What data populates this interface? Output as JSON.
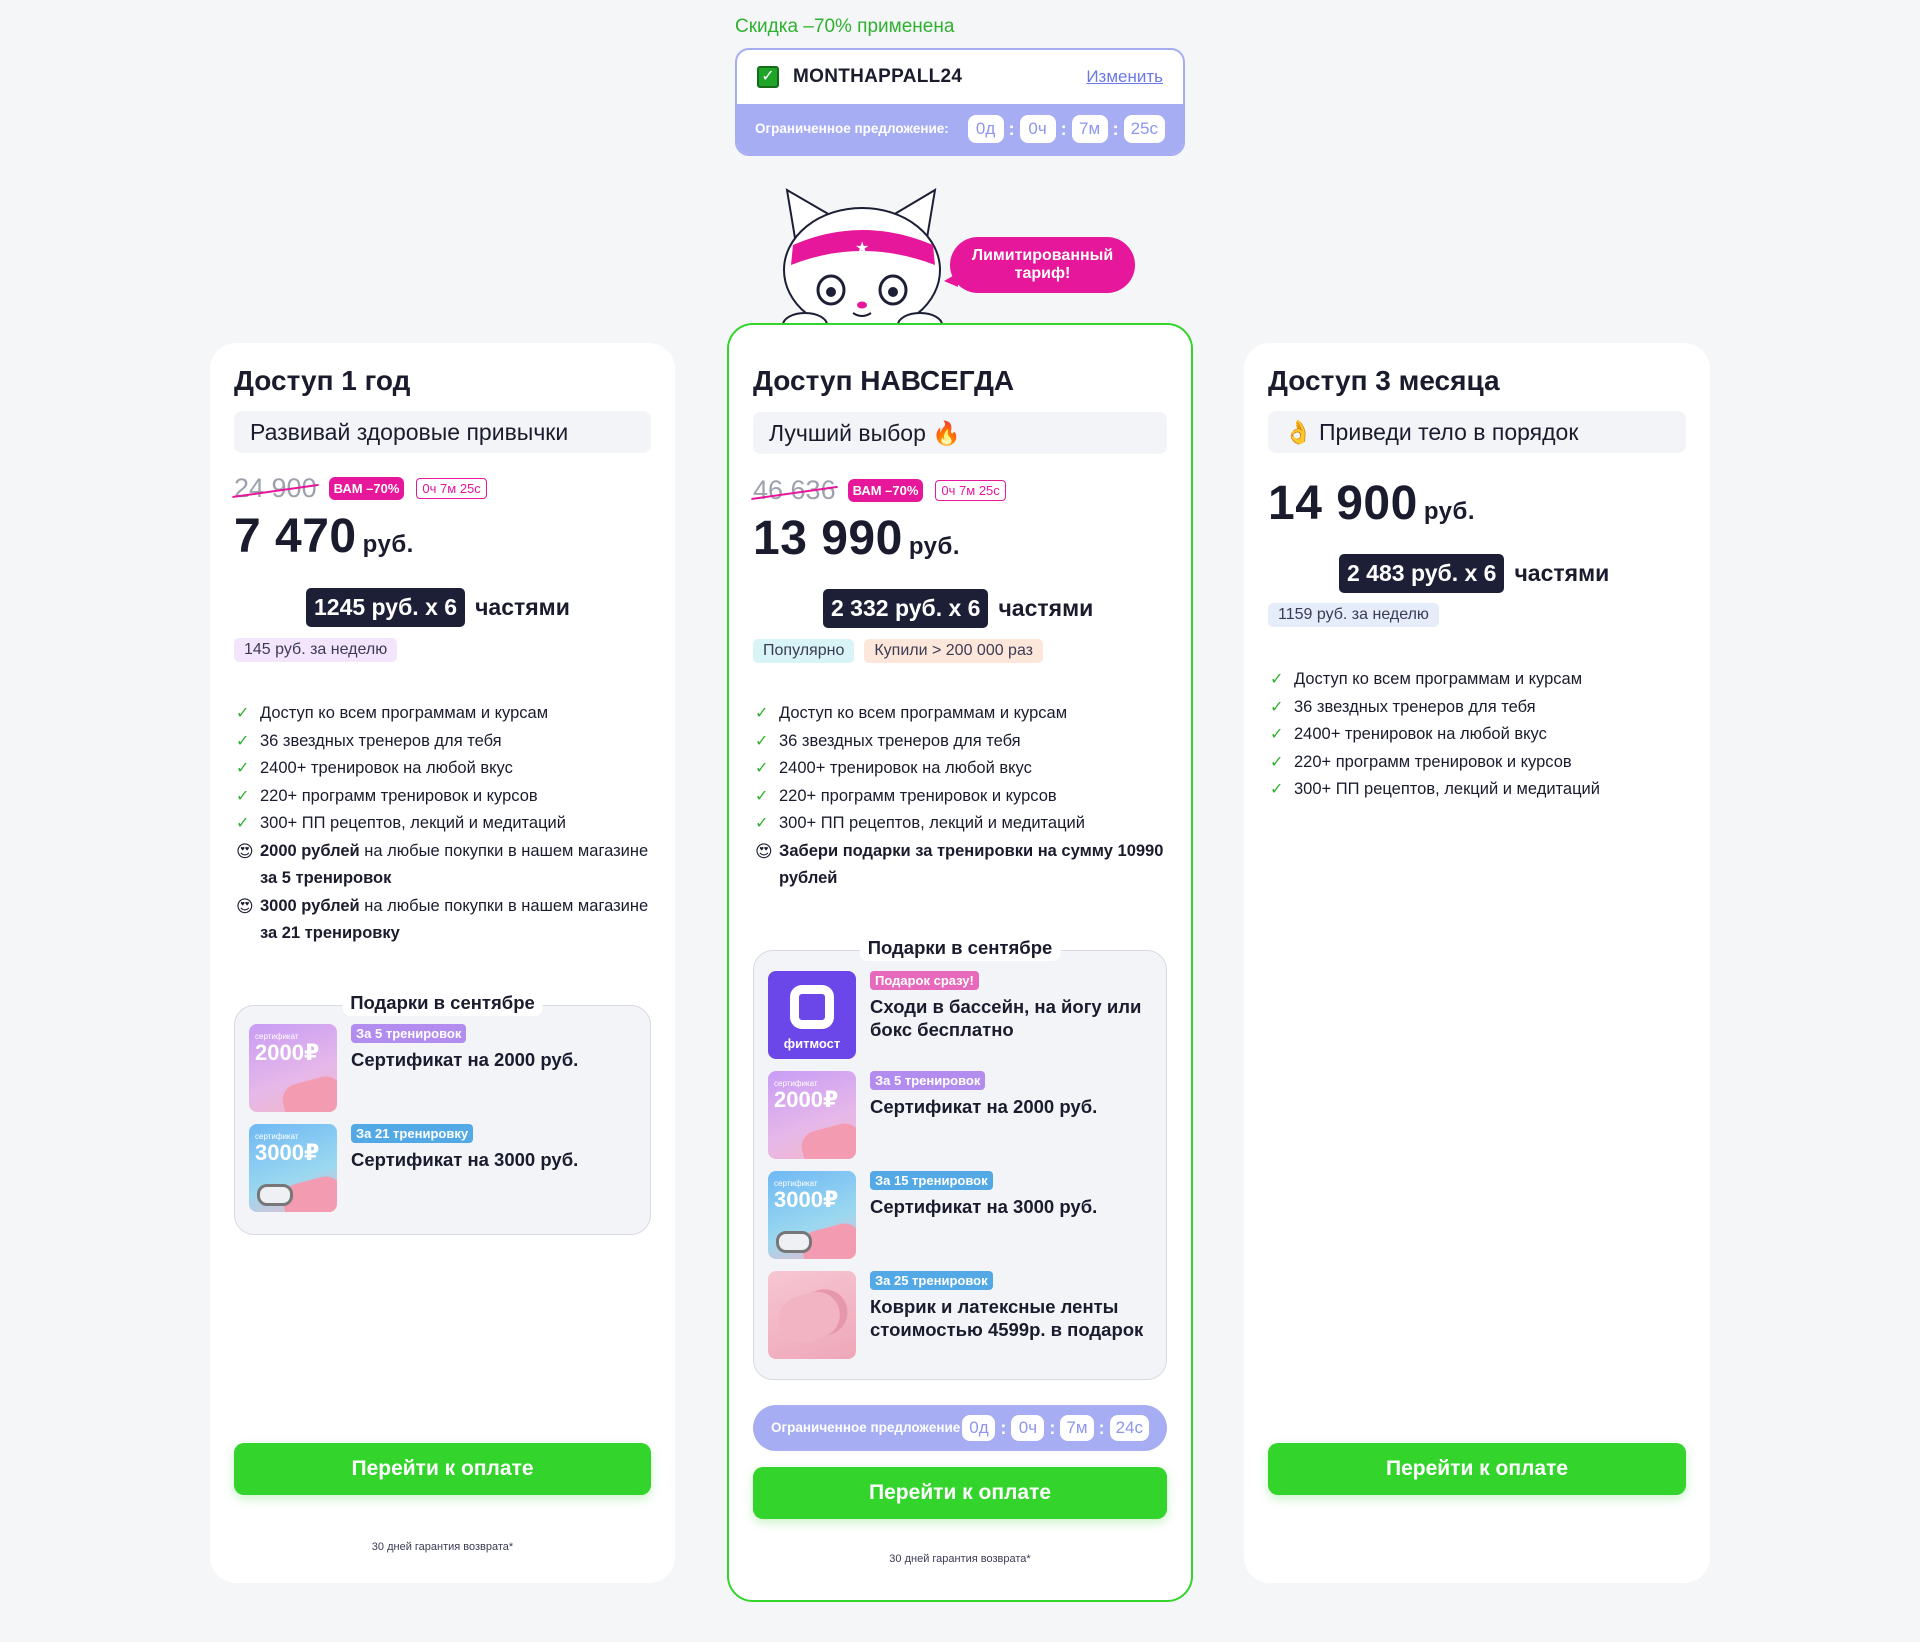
{
  "promo": {
    "applied": "Скидка –70% применена",
    "code": "MONTHAPPALL24",
    "change": "Изменить",
    "timer_label": "Ограниченное предложение:",
    "timer": [
      "0д",
      "0ч",
      "7м",
      "25с"
    ]
  },
  "bubble": "Лимитированный тариф!",
  "plans": [
    {
      "title": "Доступ 1 год",
      "subtitle": "Развивай здоровые привычки",
      "old_price": "24 900",
      "discount_badge": "ВАМ –70%",
      "countdown_badge": "0ч 7м 25с",
      "price": "7 470",
      "currency": "руб.",
      "installment": "1245 руб. x 6",
      "installment_suffix": "частями",
      "weekly": "145 руб. за неделю",
      "features": [
        "Доступ ко всем программам и курсам",
        "36 звездных тренеров для тебя",
        "2400+ тренировок на любой вкус",
        "220+ программ тренировок и курсов",
        "300+ ПП рецептов, лекций и медитаций"
      ],
      "bonus1": {
        "bold1": "2000 рублей",
        "text": " на любые покупки в нашем магазине ",
        "bold2": "за 5 тренировок"
      },
      "bonus2": {
        "bold1": "3000 рублей",
        "text": " на любые покупки в нашем магазине ",
        "bold2": "за 21 тренировку"
      },
      "gifts_title": "Подарки в сентябре",
      "gifts": [
        {
          "tag": "За 5 тренировок",
          "text": "Сертификат на 2000 руб.",
          "img_small": "сертификат",
          "img_amount": "2000₽"
        },
        {
          "tag": "За 21 тренировку",
          "text": "Сертификат на 3000 руб.",
          "img_small": "сертификат",
          "img_amount": "3000₽"
        }
      ],
      "pay": "Перейти к оплате",
      "guarantee": "30 дней гарантия возврата*"
    },
    {
      "title": "Доступ НАВСЕГДА",
      "subtitle": "Лучший выбор 🔥",
      "old_price": "46 636",
      "discount_badge": "ВАМ –70%",
      "countdown_badge": "0ч 7м 25с",
      "price": "13 990",
      "currency": "руб.",
      "installment": "2 332 руб. x 6",
      "installment_suffix": "частями",
      "chip_popular": "Популярно",
      "chip_bought": "Купили > 200 000 раз",
      "features": [
        "Доступ ко всем программам и курсам",
        "36 звездных тренеров для тебя",
        "2400+ тренировок на любой вкус",
        "220+ программ тренировок и курсов",
        "300+ ПП рецептов, лекций и медитаций"
      ],
      "bonus": "Забери подарки за тренировки на сумму 10990 рублей",
      "gifts_title": "Подарки в сентябре",
      "gifts": [
        {
          "tag": "Подарок сразу!",
          "text": "Сходи в бассейн, на йогу или бокс бесплатно",
          "img_label": "фитмост"
        },
        {
          "tag": "За 5 тренировок",
          "text": "Сертификат на 2000 руб.",
          "img_small": "сертификат",
          "img_amount": "2000₽"
        },
        {
          "tag": "За 15 тренировок",
          "text": "Сертификат на 3000 руб.",
          "img_small": "сертификат",
          "img_amount": "3000₽"
        },
        {
          "tag": "За 25 тренировок",
          "text": "Коврик и латексные ленты стоимостью 4599р. в подарок"
        }
      ],
      "timer_label": "Ограниченное предложение",
      "timer": [
        "0д",
        "0ч",
        "7м",
        "24с"
      ],
      "pay": "Перейти к оплате",
      "guarantee": "30 дней гарантия возврата*"
    },
    {
      "title": "Доступ 3 месяца",
      "subtitle": "👌 Приведи тело в порядок",
      "price": "14 900",
      "currency": "руб.",
      "installment": "2 483 руб. x 6",
      "installment_suffix": "частями",
      "weekly": "1159 руб. за неделю",
      "features": [
        "Доступ ко всем программам и курсам",
        "36 звездных тренеров для тебя",
        "2400+ тренировок на любой вкус",
        "220+ программ тренировок и курсов",
        "300+ ПП рецептов, лекций и медитаций"
      ],
      "pay": "Перейти к оплате"
    }
  ],
  "colors": {
    "accent_green": "#33d42b",
    "pink": "#e6179a",
    "lavender": "#a6adf3",
    "dark": "#1c1f35"
  }
}
